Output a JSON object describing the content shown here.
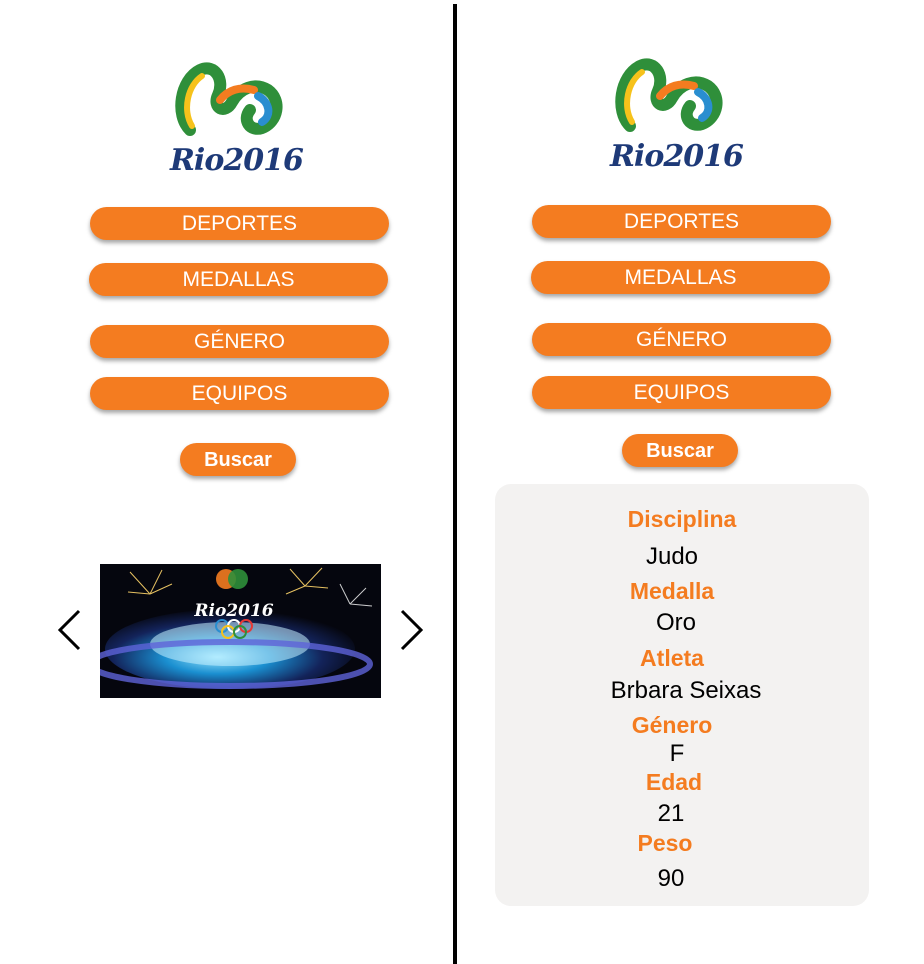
{
  "logo": {
    "wordmark": "Rio2016"
  },
  "left_panel": {
    "menu": [
      "DEPORTES",
      "MEDALLAS",
      "GÉNERO",
      "EQUIPOS"
    ],
    "search_label": "Buscar",
    "carousel": {
      "image_wordmark": "Rio2016",
      "prev_icon": "chevron-left-icon",
      "next_icon": "chevron-right-icon"
    }
  },
  "right_panel": {
    "menu": [
      "DEPORTES",
      "MEDALLAS",
      "GÉNERO",
      "EQUIPOS"
    ],
    "search_label": "Buscar",
    "result": {
      "discipline_label": "Disciplina",
      "discipline_value": "Judo",
      "medal_label": "Medalla",
      "medal_value": "Oro",
      "athlete_label": "Atleta",
      "athlete_value": "Brbara Seixas",
      "gender_label": "Género",
      "gender_value": "F",
      "age_label": "Edad",
      "age_value": "21",
      "weight_label": "Peso",
      "weight_value": "90"
    }
  },
  "colors": {
    "accent": "#f47c20",
    "card_bg": "#f3f2f1",
    "wordmark": "#1e3a78"
  }
}
